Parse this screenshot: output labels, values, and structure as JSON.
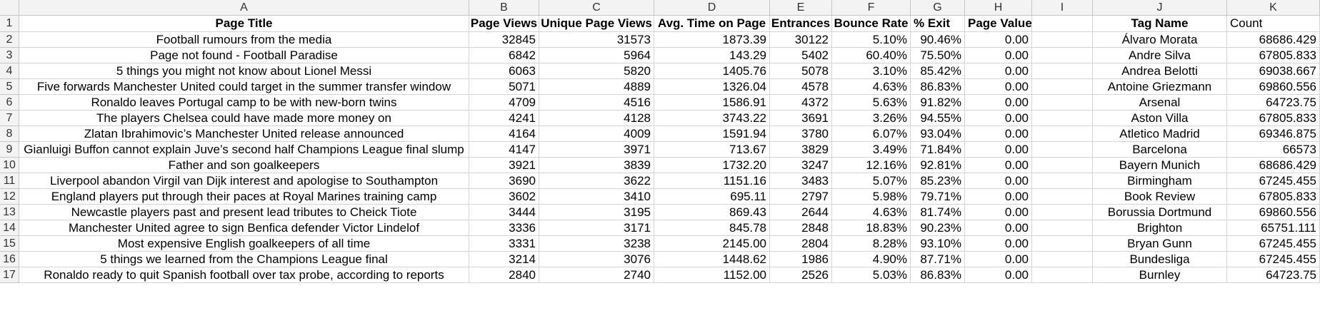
{
  "columns": [
    "A",
    "B",
    "C",
    "D",
    "E",
    "F",
    "G",
    "H",
    "I",
    "J",
    "K"
  ],
  "headers": {
    "page_title": "Page Title",
    "page_views": "Page Views",
    "unique_page_views": "Unique Page Views",
    "avg_time": "Avg. Time on Page",
    "entrances": "Entrances",
    "bounce_rate": "Bounce Rate",
    "exit": "% Exit",
    "page_value": "Page Value",
    "tag_name": "Tag Name",
    "count": "Count"
  },
  "rows": [
    {
      "num": "2",
      "title": "Football rumours from the media",
      "views": "32845",
      "unique": "31573",
      "avg": "1873.39",
      "entr": "30122",
      "bounce": "5.10%",
      "exit": "90.46%",
      "value": "0.00",
      "tag": "Álvaro Morata",
      "count": "68686.429"
    },
    {
      "num": "3",
      "title": "Page not found - Football Paradise",
      "views": "6842",
      "unique": "5964",
      "avg": "143.29",
      "entr": "5402",
      "bounce": "60.40%",
      "exit": "75.50%",
      "value": "0.00",
      "tag": "Andre Silva",
      "count": "67805.833"
    },
    {
      "num": "4",
      "title": "5 things you might not know about Lionel Messi",
      "views": "6063",
      "unique": "5820",
      "avg": "1405.76",
      "entr": "5078",
      "bounce": "3.10%",
      "exit": "85.42%",
      "value": "0.00",
      "tag": "Andrea Belotti",
      "count": "69038.667"
    },
    {
      "num": "5",
      "title": "Five forwards Manchester United could target in the summer transfer window",
      "views": "5071",
      "unique": "4889",
      "avg": "1326.04",
      "entr": "4578",
      "bounce": "4.63%",
      "exit": "86.83%",
      "value": "0.00",
      "tag": "Antoine Griezmann",
      "count": "69860.556"
    },
    {
      "num": "6",
      "title": "Ronaldo leaves Portugal camp to be with new-born twins",
      "views": "4709",
      "unique": "4516",
      "avg": "1586.91",
      "entr": "4372",
      "bounce": "5.63%",
      "exit": "91.82%",
      "value": "0.00",
      "tag": "Arsenal",
      "count": "64723.75"
    },
    {
      "num": "7",
      "title": "The players Chelsea could have made more money on",
      "views": "4241",
      "unique": "4128",
      "avg": "3743.22",
      "entr": "3691",
      "bounce": "3.26%",
      "exit": "94.55%",
      "value": "0.00",
      "tag": "Aston Villa",
      "count": "67805.833"
    },
    {
      "num": "8",
      "title": "Zlatan Ibrahimovic’s Manchester United release announced",
      "views": "4164",
      "unique": "4009",
      "avg": "1591.94",
      "entr": "3780",
      "bounce": "6.07%",
      "exit": "93.04%",
      "value": "0.00",
      "tag": "Atletico Madrid",
      "count": "69346.875"
    },
    {
      "num": "9",
      "title": "Gianluigi Buffon cannot explain Juve’s second half Champions League final slump",
      "views": "4147",
      "unique": "3971",
      "avg": "713.67",
      "entr": "3829",
      "bounce": "3.49%",
      "exit": "71.84%",
      "value": "0.00",
      "tag": "Barcelona",
      "count": "66573"
    },
    {
      "num": "10",
      "title": "Father and son goalkeepers",
      "views": "3921",
      "unique": "3839",
      "avg": "1732.20",
      "entr": "3247",
      "bounce": "12.16%",
      "exit": "92.81%",
      "value": "0.00",
      "tag": "Bayern Munich",
      "count": "68686.429"
    },
    {
      "num": "11",
      "title": "Liverpool abandon Virgil van Dijk interest and apologise to Southampton",
      "views": "3690",
      "unique": "3622",
      "avg": "1151.16",
      "entr": "3483",
      "bounce": "5.07%",
      "exit": "85.23%",
      "value": "0.00",
      "tag": "Birmingham",
      "count": "67245.455"
    },
    {
      "num": "12",
      "title": "England players put through their paces at Royal Marines training camp",
      "views": "3602",
      "unique": "3410",
      "avg": "695.11",
      "entr": "2797",
      "bounce": "5.98%",
      "exit": "79.71%",
      "value": "0.00",
      "tag": "Book Review",
      "count": "67805.833"
    },
    {
      "num": "13",
      "title": "Newcastle players past and present lead tributes to Cheick Tiote",
      "views": "3444",
      "unique": "3195",
      "avg": "869.43",
      "entr": "2644",
      "bounce": "4.63%",
      "exit": "81.74%",
      "value": "0.00",
      "tag": "Borussia Dortmund",
      "count": "69860.556"
    },
    {
      "num": "14",
      "title": "Manchester United agree to sign Benfica defender Victor Lindelof",
      "views": "3336",
      "unique": "3171",
      "avg": "845.78",
      "entr": "2848",
      "bounce": "18.83%",
      "exit": "90.23%",
      "value": "0.00",
      "tag": "Brighton",
      "count": "65751.111"
    },
    {
      "num": "15",
      "title": "Most expensive English goalkeepers of all time",
      "views": "3331",
      "unique": "3238",
      "avg": "2145.00",
      "entr": "2804",
      "bounce": "8.28%",
      "exit": "93.10%",
      "value": "0.00",
      "tag": "Bryan Gunn",
      "count": "67245.455"
    },
    {
      "num": "16",
      "title": "5 things we learned from the Champions League final",
      "views": "3214",
      "unique": "3076",
      "avg": "1448.62",
      "entr": "1986",
      "bounce": "4.90%",
      "exit": "87.71%",
      "value": "0.00",
      "tag": "Bundesliga",
      "count": "67245.455"
    },
    {
      "num": "17",
      "title": "Ronaldo ready to quit Spanish football over tax probe, according to reports",
      "views": "2840",
      "unique": "2740",
      "avg": "1152.00",
      "entr": "2526",
      "bounce": "5.03%",
      "exit": "86.83%",
      "value": "0.00",
      "tag": "Burnley",
      "count": "64723.75"
    }
  ]
}
